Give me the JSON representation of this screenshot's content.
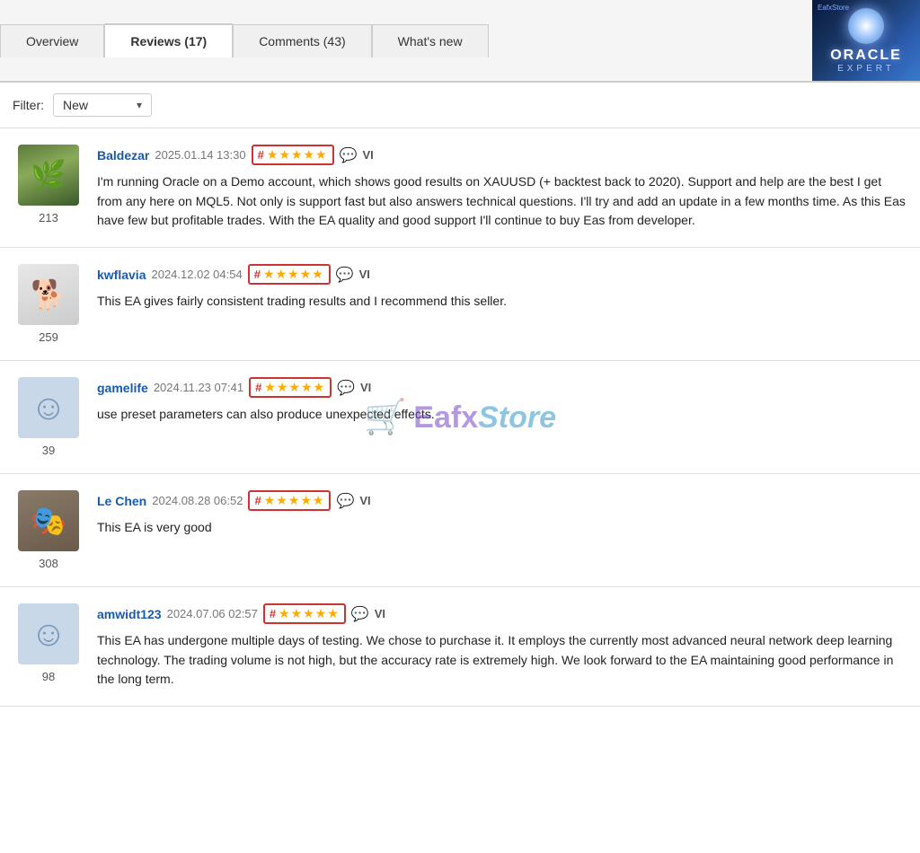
{
  "tabs": [
    {
      "id": "overview",
      "label": "Overview",
      "active": false
    },
    {
      "id": "reviews",
      "label": "Reviews (17)",
      "active": true
    },
    {
      "id": "comments",
      "label": "Comments (43)",
      "active": false
    },
    {
      "id": "whatsnew",
      "label": "What's new",
      "active": false
    }
  ],
  "logo": {
    "brand": "EafxStore",
    "title": "ORACLE",
    "subtitle": "EXPERT"
  },
  "filter": {
    "label": "Filter:",
    "value": "New"
  },
  "watermark": {
    "cart_symbol": "🛒",
    "text_eafx": "Eafx",
    "text_store": "Store"
  },
  "reviews": [
    {
      "id": 1,
      "username": "Baldezar",
      "date": "2025.01.14 13:30",
      "rating": 5,
      "lang": "VI",
      "avatar_type": "baldezar",
      "avatar_count": "213",
      "text": "I'm running Oracle on a Demo account, which shows good results on XAUUSD (+ backtest back to 2020). Support and help are the best I get from any here on MQL5. Not only is support fast but also answers technical questions. I'll try and add an update in a few months time. As this Eas have few but profitable trades. With the EA quality and good support I'll continue to buy Eas from developer."
    },
    {
      "id": 2,
      "username": "kwflavia",
      "date": "2024.12.02 04:54",
      "rating": 5,
      "lang": "VI",
      "avatar_type": "kwflavia",
      "avatar_count": "259",
      "text": "This EA gives fairly consistent trading results and I recommend this seller."
    },
    {
      "id": 3,
      "username": "gamelife",
      "date": "2024.11.23 07:41",
      "rating": 5,
      "lang": "VI",
      "avatar_type": "placeholder",
      "avatar_count": "39",
      "text": "use preset parameters can also produce unexpected effects."
    },
    {
      "id": 4,
      "username": "Le Chen",
      "date": "2024.08.28 06:52",
      "rating": 5,
      "lang": "VI",
      "avatar_type": "lechen",
      "avatar_count": "308",
      "text": "This EA is very good"
    },
    {
      "id": 5,
      "username": "amwidt123",
      "date": "2024.07.06 02:57",
      "rating": 5,
      "lang": "VI",
      "avatar_type": "placeholder",
      "avatar_count": "98",
      "text": "This EA has undergone multiple days of testing. We chose to purchase it. It employs the currently most advanced neural network deep learning technology. The trading volume is not high, but the accuracy rate is extremely high. We look forward to the EA maintaining good performance in the long term."
    }
  ]
}
